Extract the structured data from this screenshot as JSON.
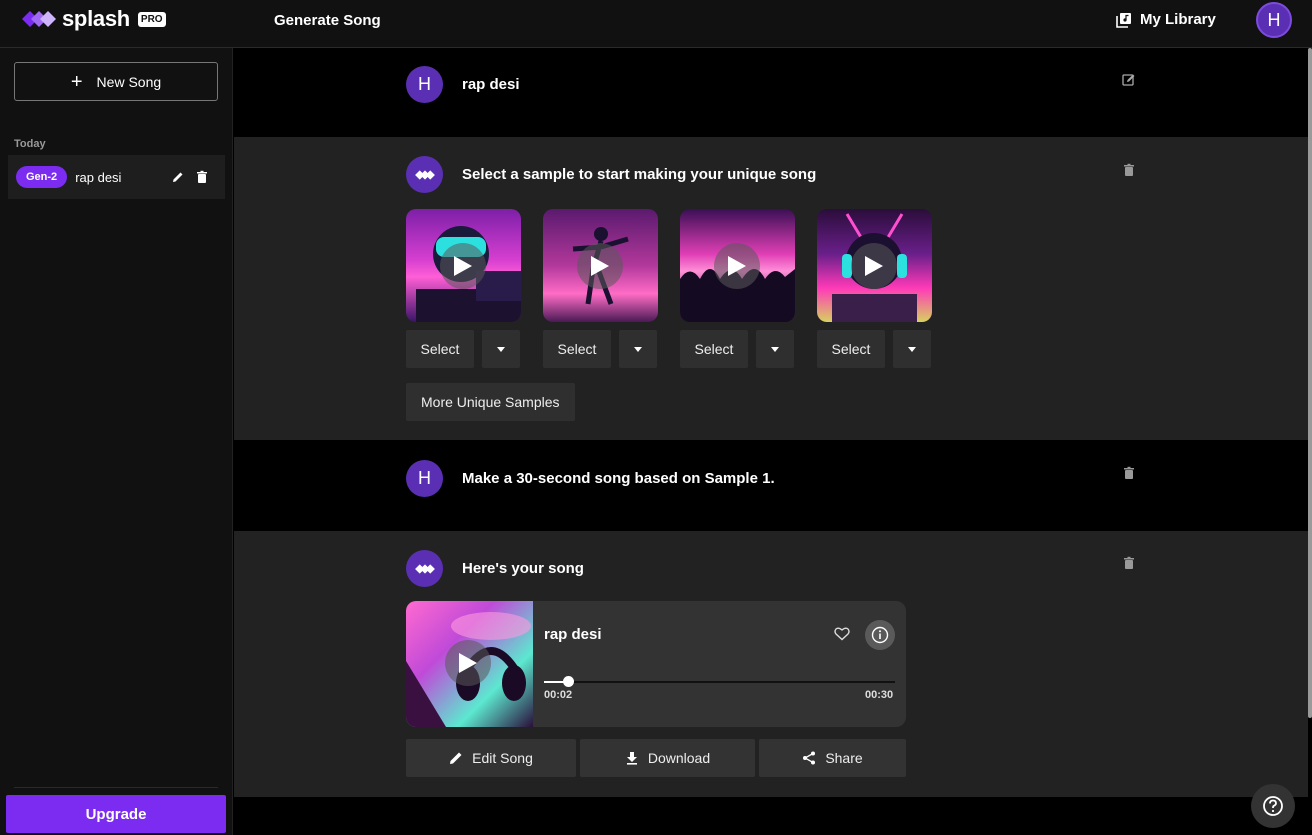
{
  "header": {
    "logo_text": "splash",
    "pro_badge": "PRO",
    "page_title": "Generate Song",
    "library_label": "My Library",
    "user_initial": "H"
  },
  "sidebar": {
    "new_song_label": "New Song",
    "section_today": "Today",
    "items": [
      {
        "badge": "Gen-2",
        "label": "rap desi"
      }
    ],
    "upgrade_label": "Upgrade"
  },
  "conversation": {
    "prompt1": {
      "avatar": "H",
      "text": "rap desi"
    },
    "samples_msg": {
      "text": "Select a sample to start making your unique song",
      "samples": [
        {
          "select_label": "Select"
        },
        {
          "select_label": "Select"
        },
        {
          "select_label": "Select"
        },
        {
          "select_label": "Select"
        }
      ],
      "more_label": "More Unique Samples"
    },
    "prompt2": {
      "avatar": "H",
      "text": "Make a 30-second song based on Sample 1."
    },
    "song_msg": {
      "text": "Here's your song",
      "song_title": "rap desi",
      "elapsed": "00:02",
      "duration": "00:30",
      "progress_fraction": 0.067,
      "edit_label": "Edit Song",
      "download_label": "Download",
      "share_label": "Share"
    }
  },
  "colors": {
    "accent": "#7b2cf0",
    "avatar": "#5b2fb3"
  }
}
